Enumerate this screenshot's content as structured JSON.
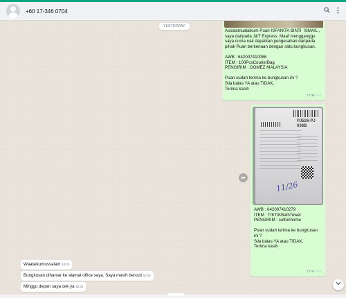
{
  "header": {
    "contact": "+60 17-346 0704",
    "icons": [
      "search-icon",
      "menu-icon"
    ]
  },
  "chat": {
    "date_chip": "YESTERDAY",
    "outgoing": [
      {
        "text": "Assalamualaikum Puan ISFANITA BINTI  ISMAIL , saya daripada J&T Express. Maaf mengganggu saya cuma nak dapatkan pengesahan daripada pihak Puan berkenaan dengan satu bungkusan.\n\nAWB : 642007410086\nITEM : 100PcsCourierBag\nPENGIRIM : GOMEZ MALAYSIA\n\nPuan sudah terima ke bungkusan ini ?\nSila balas YA atau TIDAK,\nTerima kasih",
        "time": "17:39"
      },
      {
        "photo_label": "PJ526-PJ\n038B",
        "photo_scrawl": "11/26",
        "text": "AWB : 642007410279\nITEM : TIKTIKBathTowel\nPENGIRIM : cottonhome\n\nPuan sudah terima ke bungkusan ini ?\nSila balas YA atau TIDAK,\nTerima kasih",
        "time": "17:42"
      }
    ],
    "incoming": [
      {
        "text": "Waalaikumussalam",
        "time": "18:32"
      },
      {
        "text": "Bungkusan dihantar ke alamat office saya. Saya masih bercuti",
        "time": "18:32"
      },
      {
        "text": "Minggu depan saya cek ya",
        "time": "18:33"
      }
    ]
  }
}
